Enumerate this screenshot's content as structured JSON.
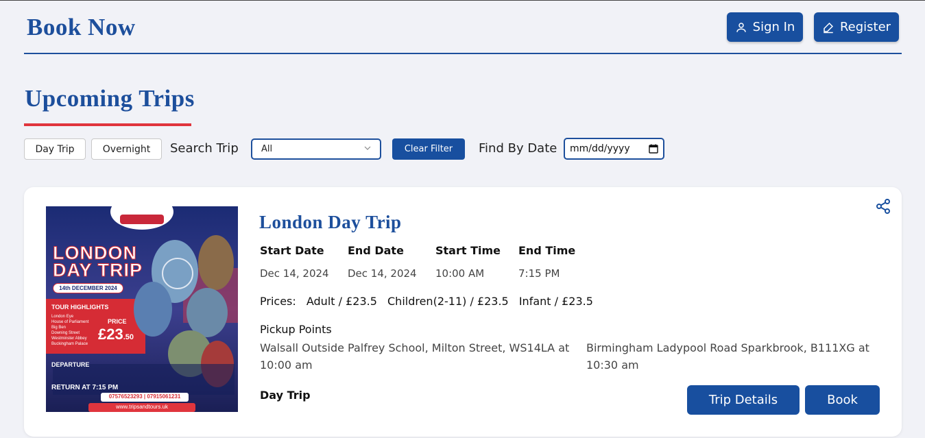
{
  "header": {
    "brand": "Book Now",
    "signin_label": "Sign In",
    "register_label": "Register"
  },
  "section": {
    "title": "Upcoming Trips"
  },
  "filters": {
    "day_trip": "Day Trip",
    "overnight": "Overnight",
    "search_label": "Search Trip",
    "search_value": "All",
    "clear_label": "Clear Filter",
    "date_label": "Find By Date",
    "date_placeholder": "mm/dd/yyyy"
  },
  "trip": {
    "title": "London Day Trip",
    "start_date_label": "Start Date",
    "end_date_label": "End Date",
    "start_time_label": "Start Time",
    "end_time_label": "End Time",
    "start_date": "Dec 14, 2024",
    "end_date": "Dec 14, 2024",
    "start_time": "10:00 AM",
    "end_time": "7:15 PM",
    "prices_label": "Prices:",
    "price_adult": "Adult / £23.5",
    "price_children": "Children(2-11) / £23.5",
    "price_infant": "Infant / £23.5",
    "pickup_label": "Pickup Points",
    "pickup_1": "Walsall Outside Palfrey School, Milton Street, WS14LA at 10:00 am",
    "pickup_2": "Birmingham Ladypool Road Sparkbrook, B111XG at 10:30 am",
    "type": "Day Trip",
    "details_label": "Trip Details",
    "book_label": "Book"
  },
  "poster": {
    "heading_1": "LONDON",
    "heading_2": "DAY TRIP",
    "date_badge": "14th DECEMBER 2024",
    "highlights_title": "TOUR HIGHLIGHTS",
    "highlights": [
      "London Eye",
      "House of Parliament",
      "Big Ben",
      "Downing Street",
      "Westminster Abbey",
      "Buckingham Palace"
    ],
    "price_label": "PRICE",
    "price_value": "£23",
    "price_decimals": ".50",
    "departure_title": "DEPARTURE",
    "return_text": "RETURN AT 7:15 PM",
    "phones": "07576523293  |  07915061231",
    "website": "www.tripsandtours.uk"
  },
  "colors": {
    "primary": "#184f9f",
    "accent_red": "#e0353d",
    "background": "#f1f2f7"
  }
}
